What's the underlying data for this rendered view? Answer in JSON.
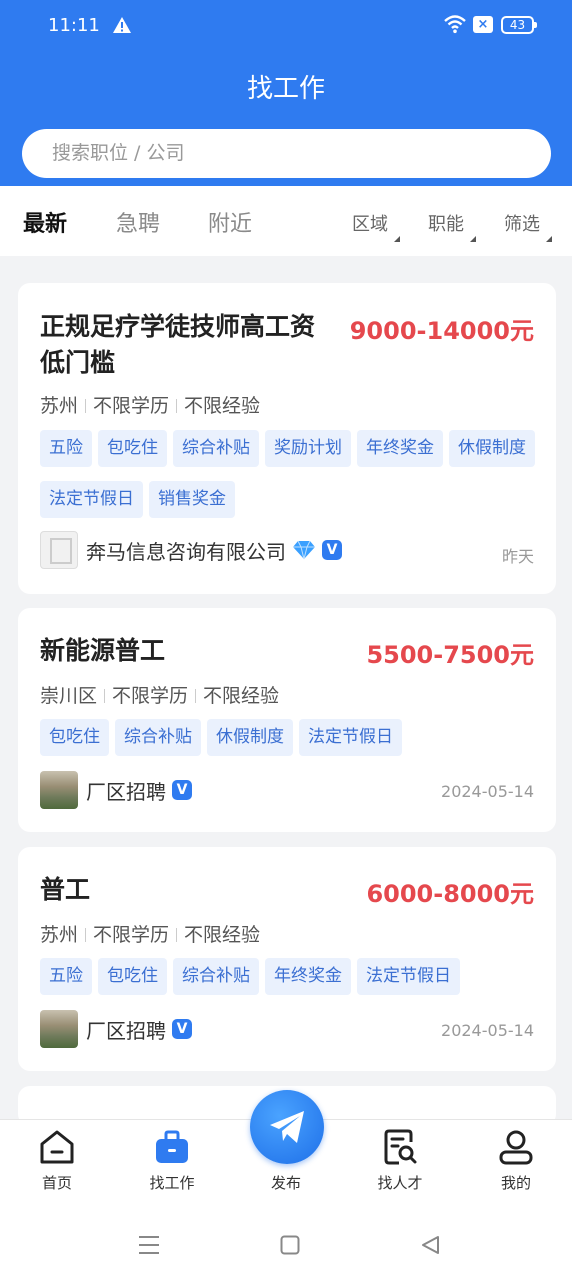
{
  "status_bar": {
    "time": "11:11",
    "battery": "43"
  },
  "header": {
    "title": "找工作",
    "search_placeholder": "搜索职位 / 公司"
  },
  "tabs": [
    {
      "label": "最新",
      "active": true
    },
    {
      "label": "急聘",
      "active": false
    },
    {
      "label": "附近",
      "active": false
    }
  ],
  "filters": [
    "区域",
    "职能",
    "筛选"
  ],
  "jobs": [
    {
      "title_line1": "正规足疗学徒技师高工资",
      "title_line2": "低门槛",
      "salary": "9000-14000元",
      "location": "苏州",
      "education": "不限学历",
      "experience": "不限经验",
      "tags": [
        "五险",
        "包吃住",
        "综合补贴",
        "奖励计划",
        "年终奖金",
        "休假制度",
        "法定节假日",
        "销售奖金"
      ],
      "company": "奔马信息咨询有限公司",
      "date": "昨天"
    },
    {
      "title": "新能源普工",
      "salary": "5500-7500元",
      "location": "崇川区",
      "education": "不限学历",
      "experience": "不限经验",
      "tags": [
        "包吃住",
        "综合补贴",
        "休假制度",
        "法定节假日"
      ],
      "company": "厂区招聘",
      "date": "2024-05-14"
    },
    {
      "title": "普工",
      "salary": "6000-8000元",
      "location": "苏州",
      "education": "不限学历",
      "experience": "不限经验",
      "tags": [
        "五险",
        "包吃住",
        "综合补贴",
        "年终奖金",
        "法定节假日"
      ],
      "company": "厂区招聘",
      "date": "2024-05-14"
    }
  ],
  "bottom_nav": {
    "home": "首页",
    "find_job": "找工作",
    "publish": "发布",
    "find_talent": "找人才",
    "mine": "我的"
  },
  "colors": {
    "primary": "#2f7bf0",
    "salary": "#e5484d",
    "tag_bg": "#eaf1fd",
    "tag_text": "#3b6fd2"
  },
  "icons": [
    "warning-icon",
    "wifi-icon",
    "home-icon",
    "briefcase-icon",
    "paper-plane-icon",
    "search-resume-icon",
    "user-icon",
    "diamond-icon",
    "verified-icon"
  ]
}
